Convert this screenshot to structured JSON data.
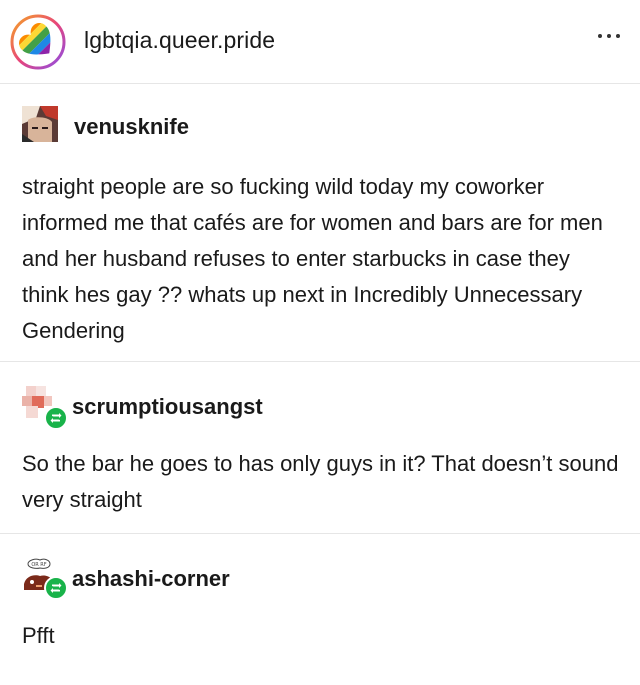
{
  "blog": {
    "name": "lgbtqia.queer.pride",
    "more_icon": "more-horizontal-icon"
  },
  "posts": [
    {
      "author": "venusknife",
      "reblog": false,
      "body": "straight people are so fucking wild today my coworker informed me that cafés are for women and bars are for men and her husband refuses to enter starbucks in case they think hes gay ?? whats up next in Incredibly Unnecessary Gendering"
    },
    {
      "author": "scrumptiousangst",
      "reblog": true,
      "body": "So the bar he goes to has only guys in it?  That doesn’t sound very straight"
    },
    {
      "author": "ashashi-corner",
      "reblog": true,
      "body": "Pfft"
    }
  ],
  "colors": {
    "reblog_badge": "#19b34a",
    "divider": "#e6e6e6"
  }
}
